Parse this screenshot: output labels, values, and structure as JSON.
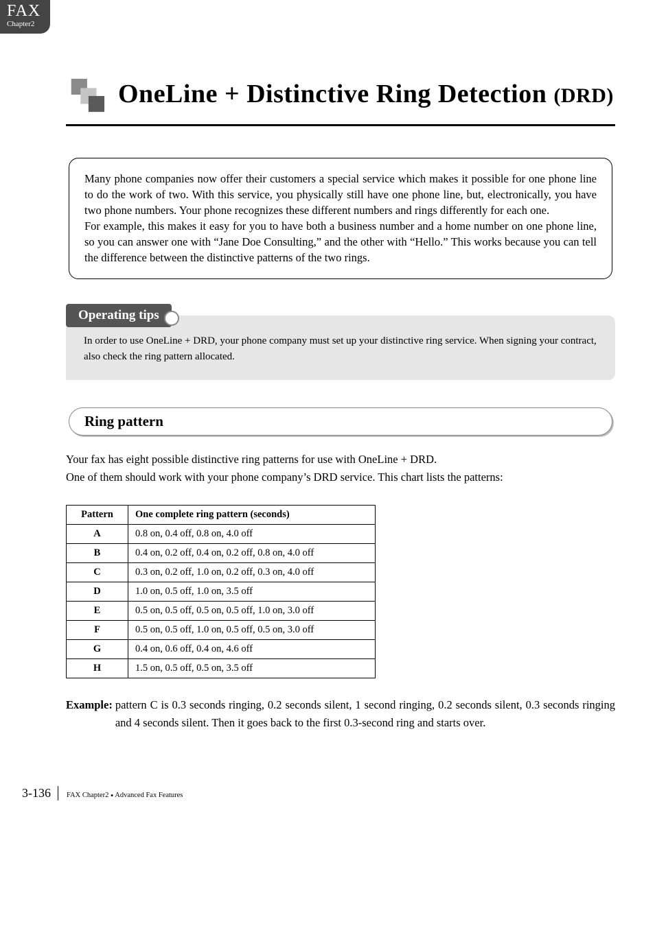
{
  "tab": {
    "line1": "FAX",
    "line2": "Chapter2"
  },
  "title": {
    "main": "OneLine + Distinctive Ring Detection ",
    "drd": "(DRD)"
  },
  "intro": {
    "p1": "Many phone companies now offer their customers a special service which makes it possible for one phone line to do the work of two. With this service, you physically still have one phone line, but, electronically, you have two phone numbers. Your phone recognizes these different numbers and rings differently for each one.",
    "p2": "For example, this makes it easy for you to have both a business number and a home number on one phone line, so you can answer one with “Jane Doe Consulting,” and the other with “Hello.” This works because you can tell the difference between the distinctive patterns of the two rings."
  },
  "tips": {
    "heading": "Operating tips",
    "body": "In order to use OneLine + DRD, your phone company must set up your distinctive ring service. When signing your contract, also check the ring pattern allocated."
  },
  "ring": {
    "heading": "Ring pattern",
    "intro1": "Your fax has eight possible distinctive ring patterns for use with OneLine + DRD.",
    "intro2": "One of them should work with your phone company’s DRD service. This chart lists the patterns:",
    "th1": "Pattern",
    "th2": "One complete ring pattern (seconds)",
    "rows": [
      {
        "p": "A",
        "d": "0.8 on, 0.4 off, 0.8 on, 4.0 off"
      },
      {
        "p": "B",
        "d": "0.4 on, 0.2 off, 0.4 on, 0.2 off, 0.8 on, 4.0 off"
      },
      {
        "p": "C",
        "d": "0.3 on, 0.2 off, 1.0 on, 0.2 off, 0.3 on, 4.0 off"
      },
      {
        "p": "D",
        "d": "1.0 on, 0.5 off, 1.0 on, 3.5 off"
      },
      {
        "p": "E",
        "d": "0.5 on, 0.5 off, 0.5 on, 0.5 off, 1.0 on, 3.0 off"
      },
      {
        "p": "F",
        "d": "0.5 on, 0.5 off, 1.0 on, 0.5 off, 0.5 on, 3.0 off"
      },
      {
        "p": "G",
        "d": "0.4 on, 0.6 off, 0.4 on, 4.6 off"
      },
      {
        "p": "H",
        "d": "1.5 on, 0.5 off, 0.5 on, 3.5 off"
      }
    ],
    "example_label": "Example:",
    "example_text": "pattern C is 0.3 seconds ringing, 0.2 seconds silent, 1 second ringing, 0.2 seconds silent, 0.3 seconds ringing and 4 seconds silent. Then it goes back to the first 0.3-second ring and starts over."
  },
  "footer": {
    "page": "3-136",
    "text1": "FAX Chapter2",
    "text2": "Advanced Fax Features"
  },
  "chart_data": {
    "type": "table",
    "title": "Ring pattern",
    "columns": [
      "Pattern",
      "One complete ring pattern (seconds)"
    ],
    "rows": [
      [
        "A",
        "0.8 on, 0.4 off, 0.8 on, 4.0 off"
      ],
      [
        "B",
        "0.4 on, 0.2 off, 0.4 on, 0.2 off, 0.8 on, 4.0 off"
      ],
      [
        "C",
        "0.3 on, 0.2 off, 1.0 on, 0.2 off, 0.3 on, 4.0 off"
      ],
      [
        "D",
        "1.0 on, 0.5 off, 1.0 on, 3.5 off"
      ],
      [
        "E",
        "0.5 on, 0.5 off, 0.5 on, 0.5 off, 1.0 on, 3.0 off"
      ],
      [
        "F",
        "0.5 on, 0.5 off, 1.0 on, 0.5 off, 0.5 on, 3.0 off"
      ],
      [
        "G",
        "0.4 on, 0.6 off, 0.4 on, 4.6 off"
      ],
      [
        "H",
        "1.5 on, 0.5 off, 0.5 on, 3.5 off"
      ]
    ]
  }
}
